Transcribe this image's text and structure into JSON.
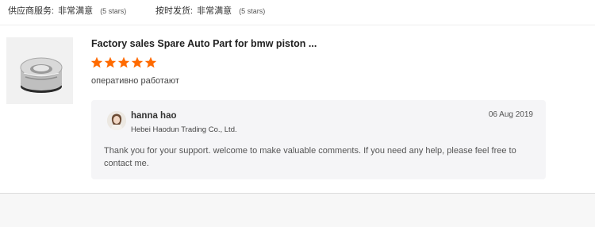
{
  "ratings": {
    "supplier_service": {
      "label": "供应商服务:",
      "value": "非常满意",
      "stars": "(5 stars)"
    },
    "on_time_shipping": {
      "label": "按时发货:",
      "value": "非常满意",
      "stars": "(5 stars)"
    }
  },
  "review": {
    "product_title": "Factory sales Spare Auto Part for bmw piston ...",
    "rating": 5,
    "star_color": "#ff6a00",
    "comment": "оперативно работают",
    "reply": {
      "name": "hanna hao",
      "company": "Hebei Haodun Trading Co., Ltd.",
      "date": "06 Aug 2019",
      "text": "Thank you for your support.  welcome to make valuable comments. If you need any help, please feel free to contact me."
    }
  }
}
